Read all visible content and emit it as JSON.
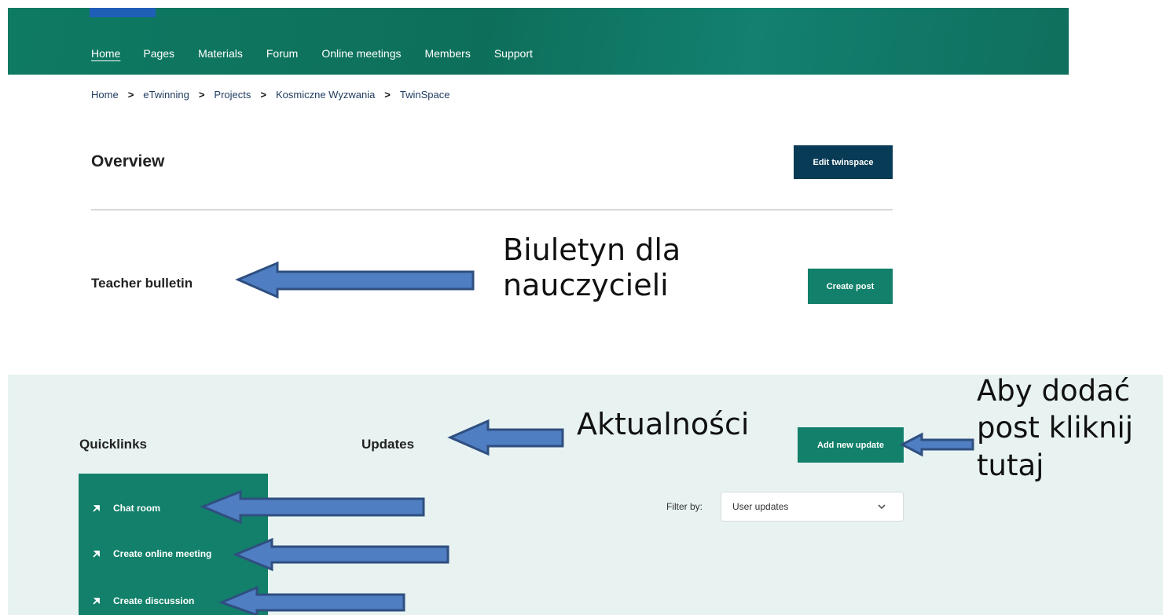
{
  "colors": {
    "nav_green": "#0f7a62",
    "dark_button": "#073b56",
    "green_button": "#12806a",
    "mint_background": "#e8f3f1",
    "arrow_fill": "#4f7ec2",
    "arrow_stroke": "#2f4f80",
    "logo_blue": "#1f5fb8"
  },
  "nav": {
    "items": [
      {
        "label": "Home",
        "active": true
      },
      {
        "label": "Pages"
      },
      {
        "label": "Materials"
      },
      {
        "label": "Forum"
      },
      {
        "label": "Online meetings"
      },
      {
        "label": "Members"
      },
      {
        "label": "Support"
      }
    ]
  },
  "breadcrumb": [
    "Home",
    "eTwinning",
    "Projects",
    "Kosmiczne Wyzwania",
    "TwinSpace"
  ],
  "breadcrumb_separator": ">",
  "overview": {
    "title": "Overview",
    "edit_button": "Edit twinspace"
  },
  "bulletin": {
    "title": "Teacher bulletin",
    "create_button": "Create post"
  },
  "quicklinks": {
    "title": "Quicklinks",
    "items": [
      {
        "label": "Chat room",
        "icon": "arrow-upright-icon"
      },
      {
        "label": "Create online meeting",
        "icon": "arrow-upright-icon"
      },
      {
        "label": "Create discussion",
        "icon": "arrow-upright-icon"
      }
    ]
  },
  "updates": {
    "title": "Updates",
    "add_button": "Add new update",
    "filter_label": "Filter by:",
    "filter_value": "User updates",
    "filter_icon": "chevron-down-icon"
  },
  "annotations": {
    "bulletin_line1": "Biuletyn dla",
    "bulletin_line2": "nauczycieli",
    "updates": "Aktualności",
    "add_line1": "Aby dodać",
    "add_line2": "post kliknij",
    "add_line3": "tutaj"
  }
}
